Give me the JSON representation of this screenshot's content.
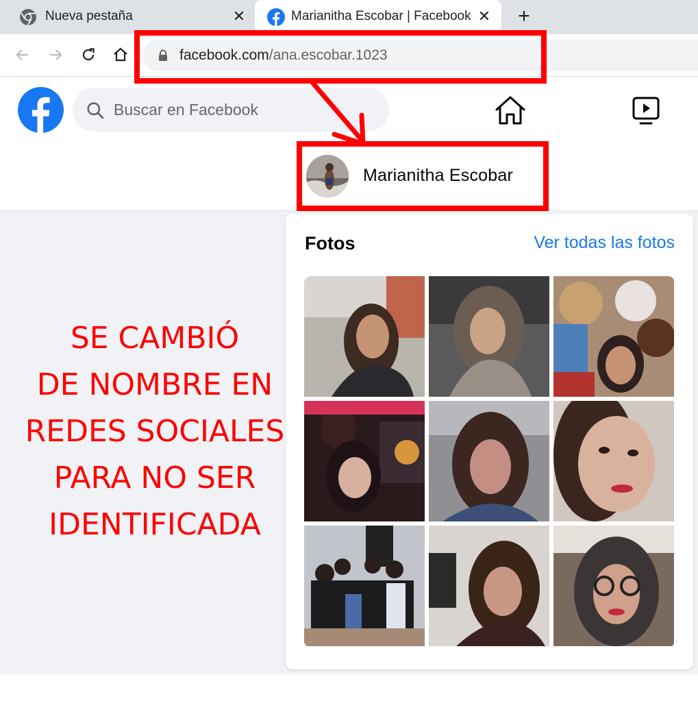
{
  "browser": {
    "tabs": [
      {
        "title": "Nueva pestaña",
        "icon": "chrome-icon",
        "active": false
      },
      {
        "title": "Marianitha Escobar | Facebook",
        "icon": "facebook-icon",
        "active": true
      }
    ],
    "new_tab_icon": "plus-icon",
    "close_icon": "close-icon",
    "nav_icons": [
      "back-arrow-icon",
      "forward-arrow-icon",
      "reload-icon",
      "home-icon"
    ],
    "address": {
      "domain": "facebook.com",
      "path": "/ana.escobar.1023",
      "icon": "lock-icon"
    }
  },
  "facebook": {
    "search_placeholder": "Buscar en Facebook",
    "nav_icons": [
      "facebook-logo",
      "home-icon",
      "watch-icon"
    ],
    "brand_color": "#1877f2",
    "profile_name": "Marianitha Escobar",
    "photos": {
      "title": "Fotos",
      "see_all": "Ver todas las fotos",
      "count": 9
    }
  },
  "annotation": {
    "color": "#ff0000",
    "caption_lines": [
      "SE CAMBIÓ",
      "DE NOMBRE EN",
      "REDES SOCIALES",
      "PARA NO SER",
      "IDENTIFICADA"
    ]
  }
}
